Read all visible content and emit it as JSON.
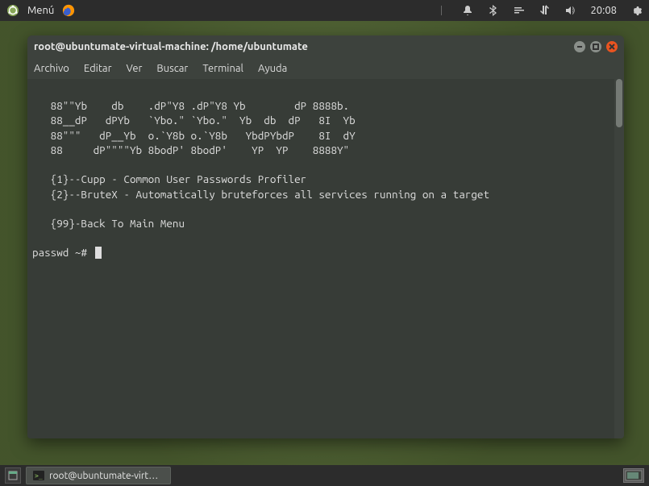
{
  "top_panel": {
    "menu_label": "Menú",
    "time": "20:08"
  },
  "window": {
    "title": "root@ubuntumate-virtual-machine: /home/ubuntumate",
    "menubar": {
      "file": "Archivo",
      "edit": "Editar",
      "view": "Ver",
      "search": "Buscar",
      "terminal": "Terminal",
      "help": "Ayuda"
    }
  },
  "terminal": {
    "ascii": [
      "   88\"\"Yb    db    .dP\"Y8 .dP\"Y8 Yb        dP 8888b.",
      "   88__dP   dPYb   `Ybo.\" `Ybo.\"  Yb  db  dP   8I  Yb",
      "   88\"\"\"   dP__Yb  o.`Y8b o.`Y8b   YbdPYbdP    8I  dY",
      "   88     dP\"\"\"\"Yb 8bodP' 8bodP'    YP  YP    8888Y\""
    ],
    "items": [
      "   {1}--Cupp - Common User Passwords Profiler",
      "   {2}--BruteX - Automatically bruteforces all services running on a target"
    ],
    "back": "   {99}-Back To Main Menu",
    "prompt": "passwd ~# "
  },
  "taskbar": {
    "button_label": "root@ubuntumate-virt…"
  }
}
